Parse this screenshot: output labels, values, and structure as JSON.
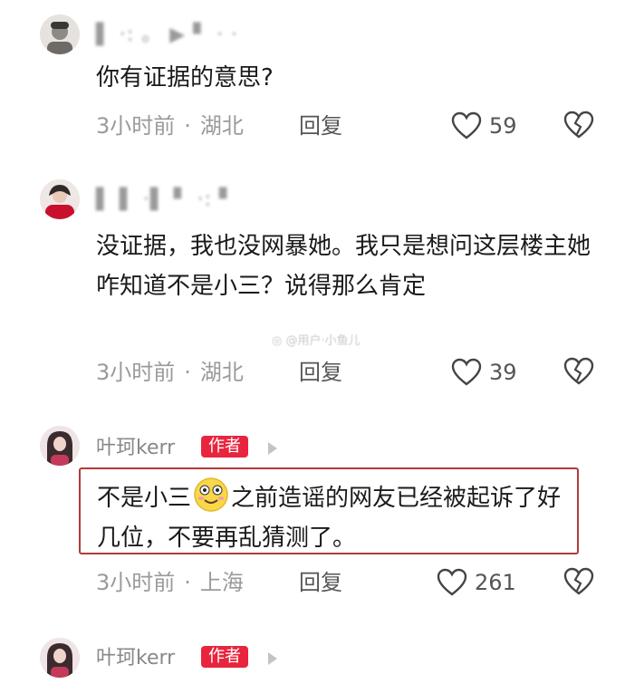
{
  "comments": [
    {
      "username": "▌ ·: 。 ▶ ▘ · ·",
      "text": "你有证据的意思?",
      "time": "3小时前",
      "location": "湖北",
      "reply_label": "回复",
      "likes": "59"
    },
    {
      "username": "▌ ▌ ·▌ ▘ ·: ▘",
      "text": "没证据，我也没网暴她。我只是想问这层楼主她咋知道不是小三？说得那么肯定",
      "time": "3小时前",
      "location": "湖北",
      "reply_label": "回复",
      "likes": "39"
    },
    {
      "username": "叶珂kerr",
      "badge": "作者",
      "text_before_emoji": "不是小三",
      "text_after_emoji": "之前造谣的网友已经被起诉了好几位，不要再乱猜测了。",
      "time": "3小时前",
      "location": "上海",
      "reply_label": "回复",
      "likes": "261"
    },
    {
      "username": "叶珂kerr",
      "badge": "作者"
    }
  ],
  "watermark": "◎ @用户·小鱼儿",
  "colors": {
    "badge": "#e8253e",
    "highlight_border": "#b23a3a",
    "meta": "#9a9a9a"
  }
}
